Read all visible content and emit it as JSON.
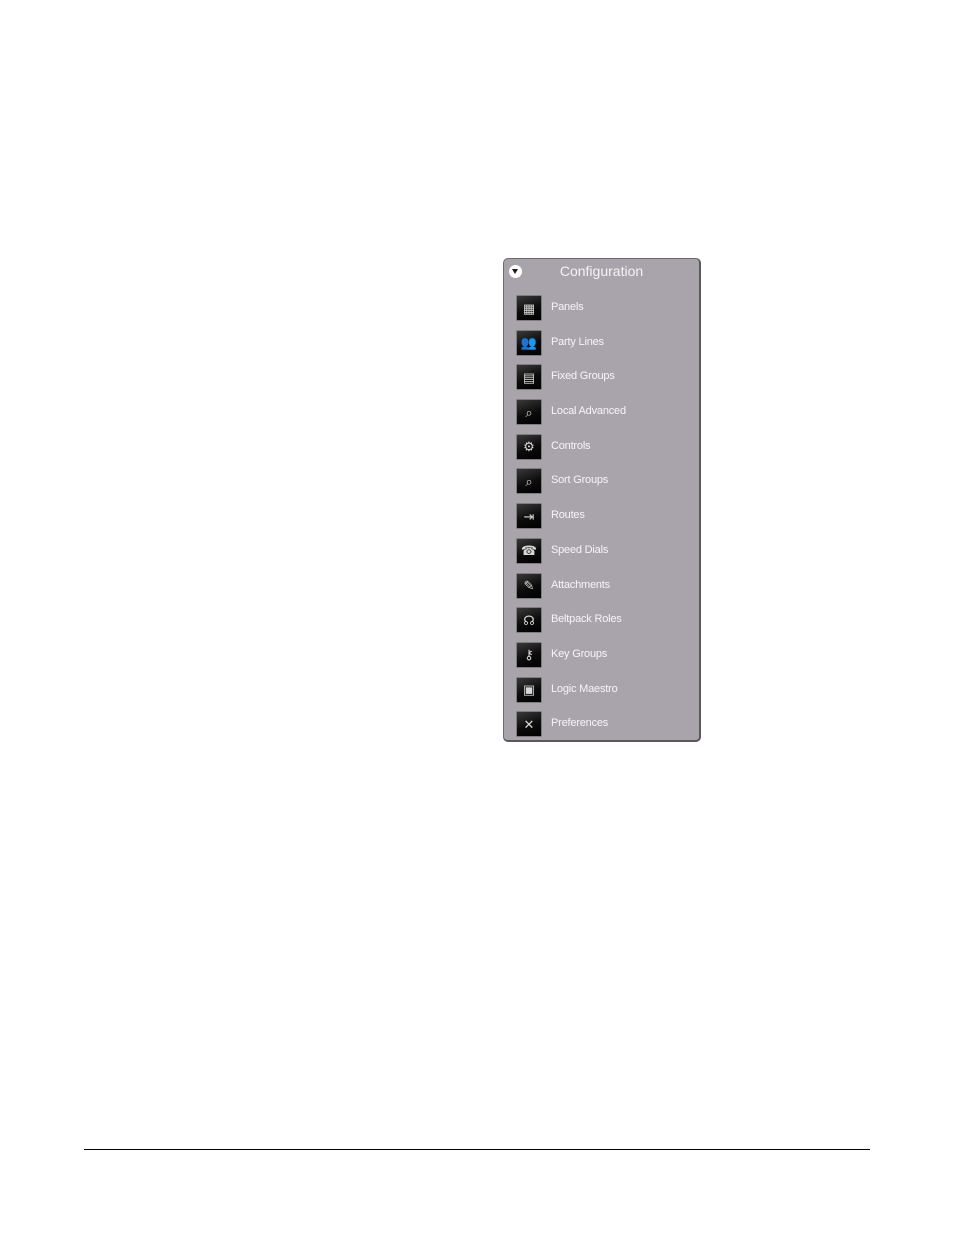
{
  "panel": {
    "title": "Configuration",
    "toggle_icon": "chevron-down-circle-icon",
    "items": [
      {
        "label": "Panels",
        "icon": "panels-icon",
        "glyph": "▦"
      },
      {
        "label": "Party Lines",
        "icon": "party-lines-icon",
        "glyph": "👥"
      },
      {
        "label": "Fixed Groups",
        "icon": "fixed-groups-icon",
        "glyph": "▤"
      },
      {
        "label": "Local Advanced",
        "icon": "local-advanced-icon",
        "glyph": "⌕"
      },
      {
        "label": "Controls",
        "icon": "controls-icon",
        "glyph": "⚙"
      },
      {
        "label": "Sort Groups",
        "icon": "sort-groups-icon",
        "glyph": "⌕"
      },
      {
        "label": "Routes",
        "icon": "routes-icon",
        "glyph": "⇥"
      },
      {
        "label": "Speed Dials",
        "icon": "speed-dials-icon",
        "glyph": "☎"
      },
      {
        "label": "Attachments",
        "icon": "attachments-icon",
        "glyph": "✎"
      },
      {
        "label": "Beltpack Roles",
        "icon": "beltpack-roles-icon",
        "glyph": "☊"
      },
      {
        "label": "Key Groups",
        "icon": "key-groups-icon",
        "glyph": "⚷"
      },
      {
        "label": "Logic Maestro",
        "icon": "logic-maestro-icon",
        "glyph": "▣"
      },
      {
        "label": "Preferences",
        "icon": "preferences-icon",
        "glyph": "✕"
      }
    ]
  },
  "colors": {
    "panel_bg": "#a9a4ab",
    "text": "#f6f5f8"
  }
}
